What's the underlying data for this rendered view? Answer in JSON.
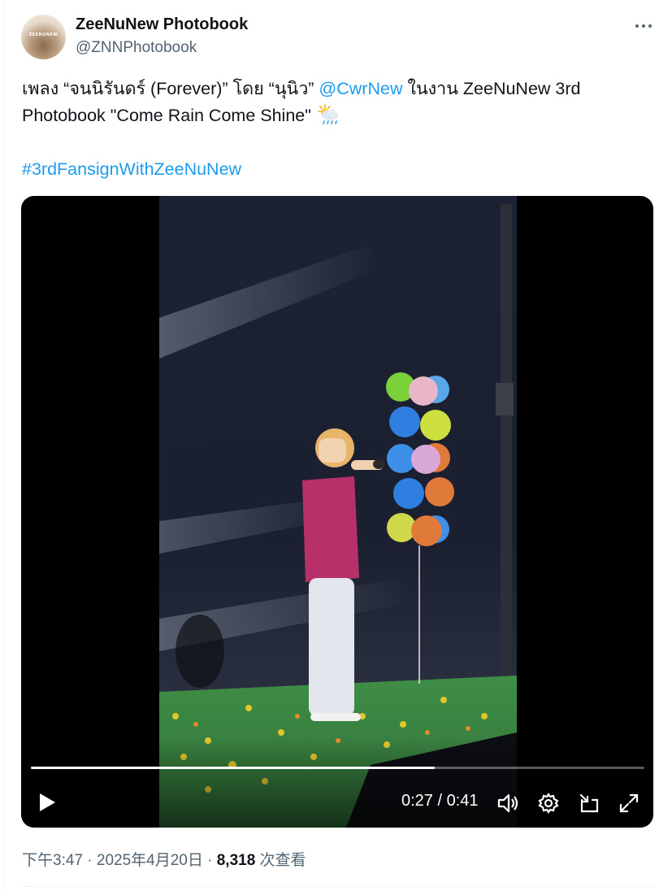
{
  "author": {
    "display_name": "ZeeNuNew Photobook",
    "handle": "@ZNNPhotobook",
    "avatar_text": "ZEENUNEW"
  },
  "tweet": {
    "text_part1": "เพลง “จนนิรันดร์ (Forever)” โดย “นุนิว” ",
    "mention": "@CwrNew",
    "text_part2": " ในงาน ZeeNuNew 3rd Photobook \"Come Rain Come Shine\"",
    "emoji": "sun-behind-rain-cloud-emoji",
    "hashtag": "#3rdFansignWithZeeNuNew"
  },
  "video": {
    "current_time": "0:27",
    "duration": "0:41",
    "time_display": "0:27 / 0:41",
    "progress": 0.6585
  },
  "footer": {
    "time": "下午3:47",
    "separator1": " · ",
    "date": "2025年4月20日",
    "separator2": " · ",
    "view_count": "8,318",
    "views_label": " 次查看"
  },
  "colors": {
    "accent": "#1d9bf0",
    "text": "#0f1419",
    "muted": "#536471"
  }
}
